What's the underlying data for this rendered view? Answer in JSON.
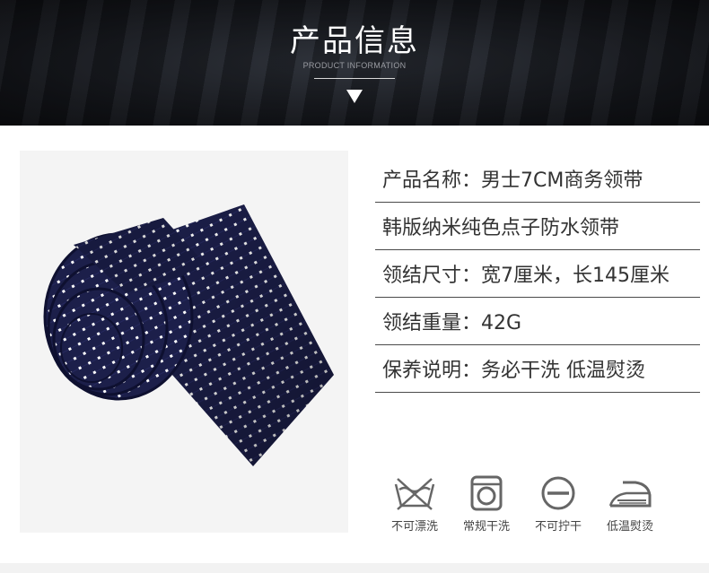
{
  "header": {
    "title": "产品信息",
    "subtitle": "PRODUCT INFORMATION"
  },
  "product_info": [
    "产品名称：男士7CM商务领带",
    "韩版纳米纯色点子防水领带",
    "领结尺寸：宽7厘米，长145厘米",
    "领结重量：42G",
    "保养说明：务必干洗  低温熨烫"
  ],
  "care_icons": [
    {
      "icon": "no-wash-icon",
      "label": "不可漂洗"
    },
    {
      "icon": "dry-clean-icon",
      "label": "常规干洗"
    },
    {
      "icon": "no-wring-icon",
      "label": "不可拧干"
    },
    {
      "icon": "low-iron-icon",
      "label": "低温熨烫"
    }
  ],
  "colors": {
    "tie_navy": "#1c1f4a",
    "tie_dot": "#ffffff",
    "banner_dark": "#14161b"
  }
}
